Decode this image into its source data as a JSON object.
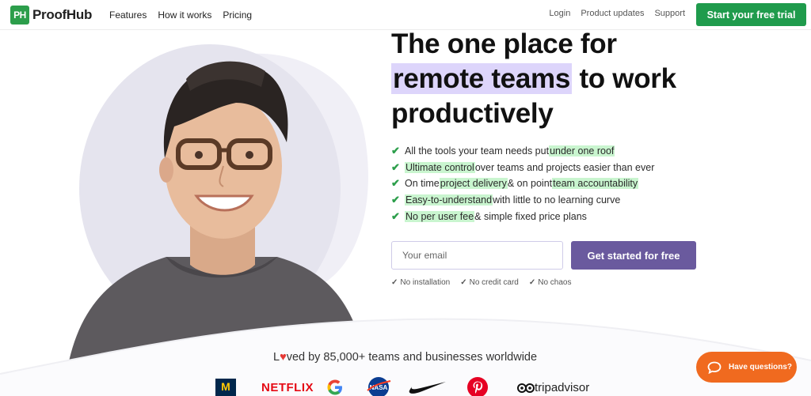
{
  "nav": {
    "logo_mark": "PH",
    "logo_text": "ProofHub",
    "links": [
      "Features",
      "How it works",
      "Pricing"
    ],
    "right_links": [
      "Login",
      "Product updates",
      "Support"
    ],
    "cta": "Start your free trial"
  },
  "hero": {
    "headline_line1": "The one place for",
    "headline_highlight": "remote teams",
    "headline_line2_rest": " to work",
    "headline_line3": "productively",
    "features": [
      {
        "pre": "All the tools your team needs put ",
        "hl": "under one roof",
        "post": ""
      },
      {
        "pre": "",
        "hl": "Ultimate control",
        "post": " over teams and projects easier than ever"
      },
      {
        "pre": "On time ",
        "hl": "project delivery",
        "mid": " & on point ",
        "hl2": "team accountability",
        "post": ""
      },
      {
        "pre": "",
        "hl": "Easy-to-understand",
        "post": " with little to no learning curve"
      },
      {
        "pre": "",
        "hl": "No per user fee",
        "post": " & simple fixed price plans"
      }
    ],
    "email_placeholder": "Your email",
    "cta": "Get started for free",
    "perks": [
      "No installation",
      "No credit card",
      "No chaos"
    ]
  },
  "social_proof": {
    "loved_pre": "L",
    "loved_heart": "♥",
    "loved_post": "ved by 85,000+ teams and businesses worldwide",
    "logos": [
      "michigan-logo",
      "NETFLIX",
      "google-logo",
      "nasa-logo",
      "nike-logo",
      "pinterest-logo",
      "tripadvisor"
    ]
  },
  "chat": {
    "label": "Have questions?"
  },
  "colors": {
    "brand_green": "#1f9b4c",
    "cta_purple": "#6a5a9e",
    "highlight_purple": "#ddd5fb",
    "highlight_green": "#c9f5cf",
    "chat_orange": "#f06a1f"
  }
}
